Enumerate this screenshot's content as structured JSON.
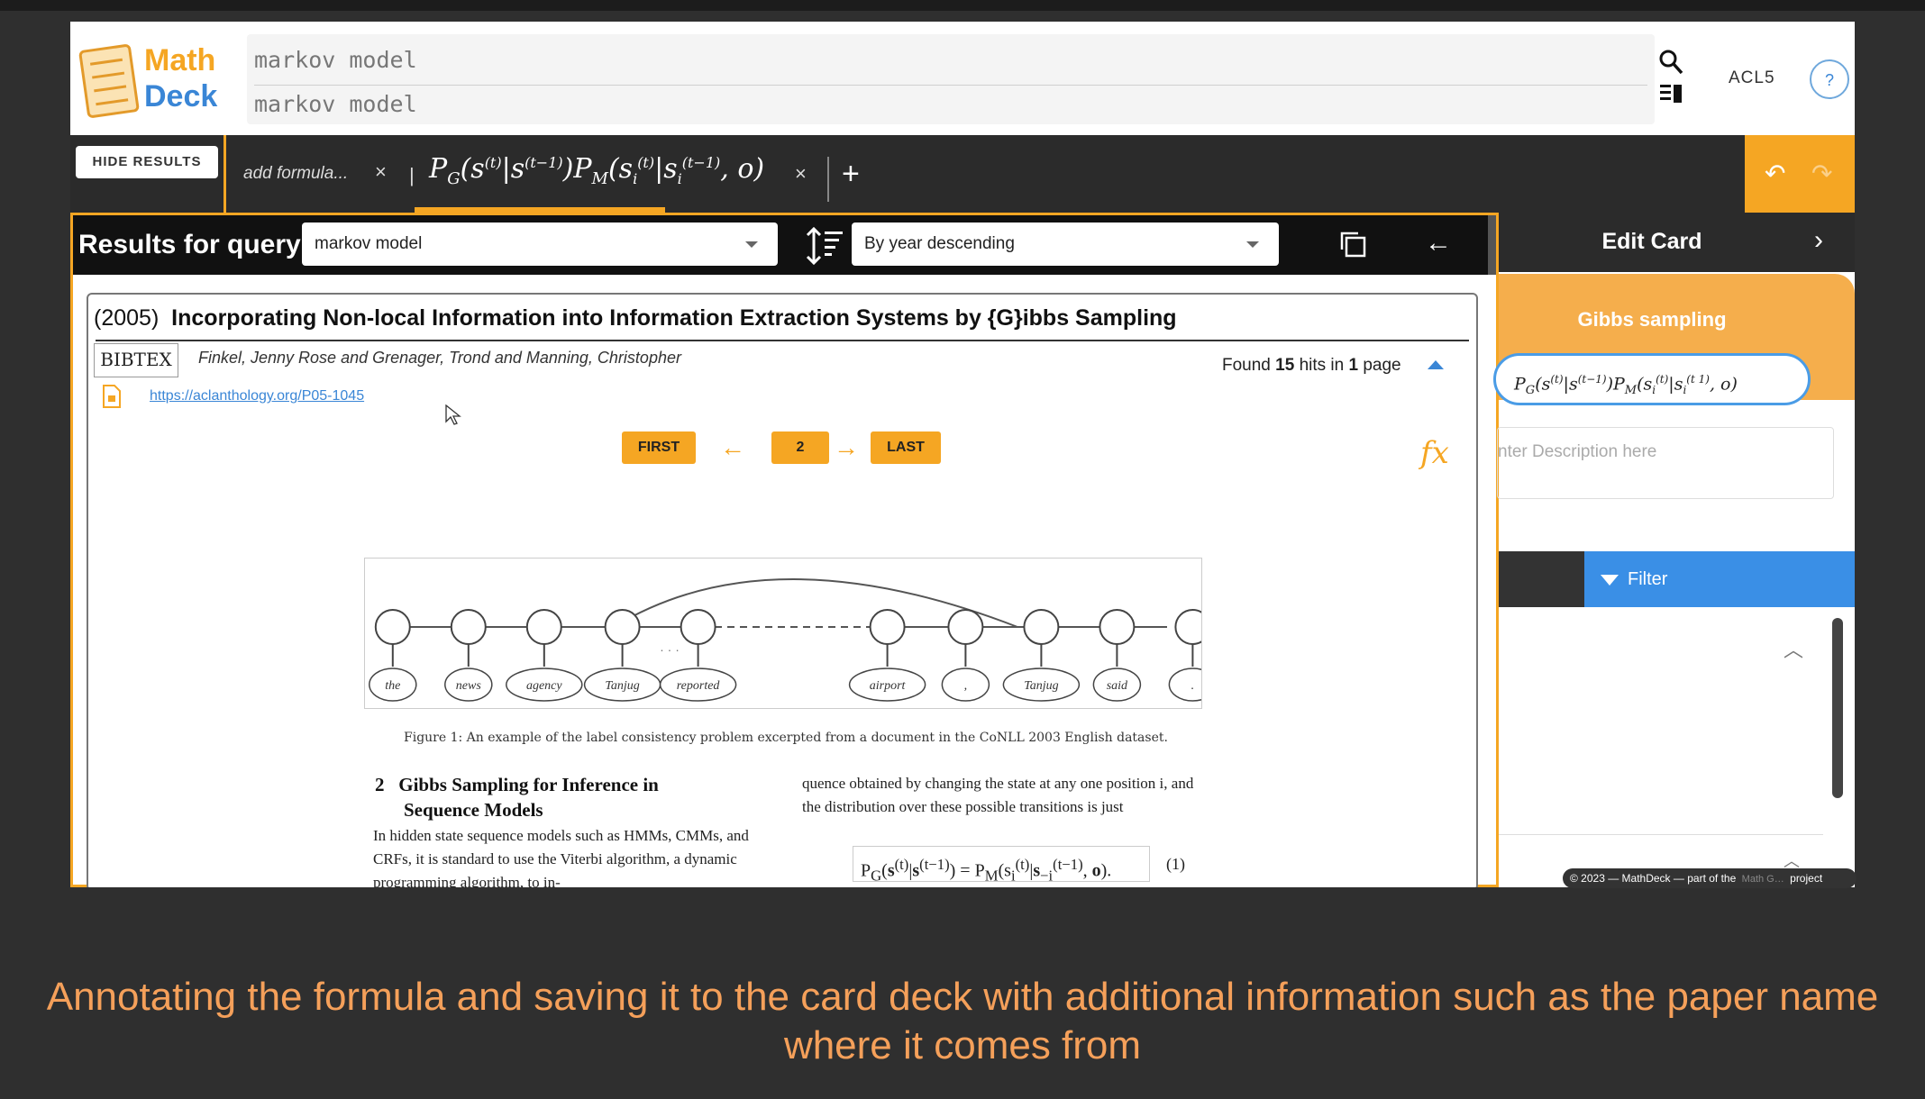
{
  "header": {
    "logo_math": "Math",
    "logo_deck": "Deck",
    "query_lines": [
      "markov model",
      "markov model"
    ],
    "acl_label": "ACL5",
    "help_label": "?"
  },
  "tabs": {
    "hide_results": "HIDE RESULTS",
    "add_formula": "add formula...",
    "close": "×",
    "plus": "+"
  },
  "results": {
    "label": "Results for query:",
    "query_select": "markov model",
    "sort_select": "By year descending"
  },
  "paper": {
    "year": "(2005)",
    "title": "Incorporating Non-local Information into Information Extraction Systems by {G}ibbs Sampling",
    "bibtex": "BIBTEX",
    "authors": "Finkel, Jenny Rose and Grenager, Trond and Manning, Christopher",
    "found_prefix": "Found ",
    "hits": "15",
    "found_mid": " hits in ",
    "pages": "1",
    "found_suffix": " page",
    "link": "https://aclanthology.org/P05-1045"
  },
  "pager": {
    "first": "FIRST",
    "current": "2",
    "last": "LAST",
    "fx": "fx"
  },
  "figure": {
    "words": [
      "the",
      "news",
      "agency",
      "Tanjug",
      "reported",
      "...",
      "airport",
      ",",
      "Tanjug",
      "said",
      "."
    ],
    "caption": "Figure 1: An example of the label consistency problem excerpted from a document in the CoNLL 2003 English dataset."
  },
  "content": {
    "section_number": "2",
    "section_title_1": "Gibbs Sampling for Inference in",
    "section_title_2": "Sequence Models",
    "left_text": "In hidden state sequence models such as HMMs, CMMs, and CRFs, it is standard to use the Viterbi algorithm, a dynamic programming algorithm, to in-",
    "right_text": "quence obtained by changing the state at any one position i, and the distribution over these possible transitions is just",
    "equation_number": "(1)"
  },
  "edit_card": {
    "title": "Edit Card",
    "card_name": "Gibbs sampling",
    "description_placeholder": "nter Description here",
    "filter_label": "Filter",
    "footer_text": "© 2023 — MathDeck — part of the",
    "footer_project": "project"
  },
  "caption": {
    "line1": "Annotating the formula and saving it to the card deck with additional information such as the paper name",
    "line2": "where it comes from"
  },
  "colors": {
    "accent": "#f5a623",
    "blue": "#3a86d6",
    "caption": "#f5a05a"
  }
}
